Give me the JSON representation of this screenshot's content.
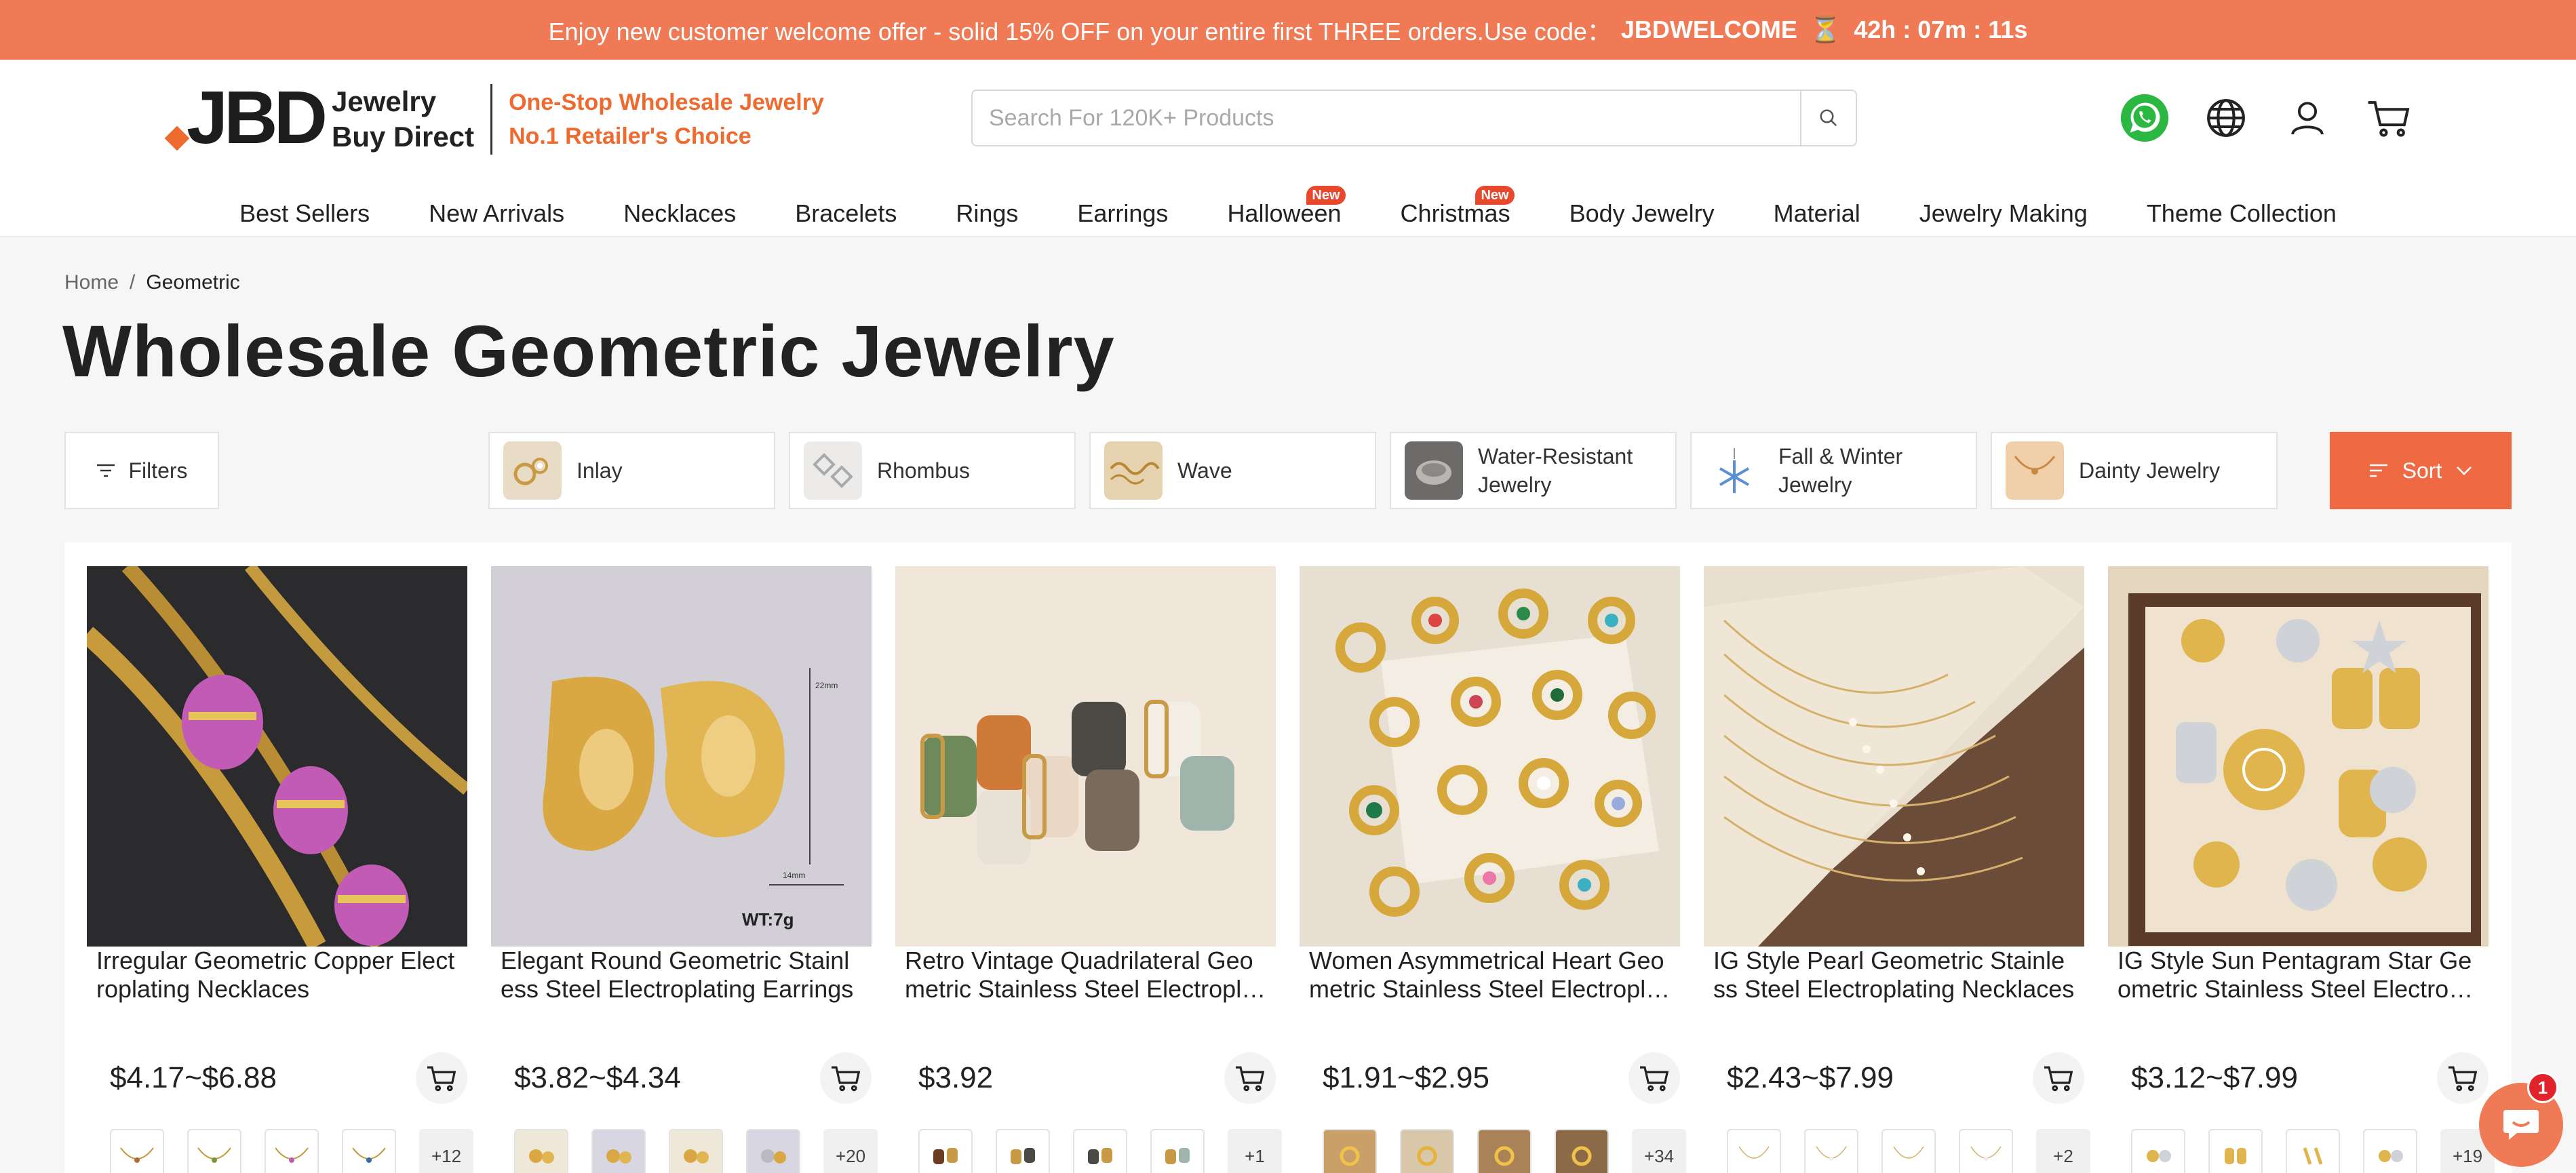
{
  "promo": {
    "text": "Enjoy new customer welcome offer - solid 15% OFF on your entire first THREE orders.Use code：",
    "code": "JBDWELCOME",
    "timer": "42h : 07m : 11s"
  },
  "header": {
    "logo_mark": "JBD",
    "logo_line1": "Jewelry",
    "logo_line2": "Buy Direct",
    "tagline1": "One-Stop Wholesale Jewelry",
    "tagline2": "No.1 Retailer's Choice",
    "search_placeholder": "Search For 120K+ Products"
  },
  "nav": [
    {
      "label": "Best Sellers",
      "badge": ""
    },
    {
      "label": "New Arrivals",
      "badge": ""
    },
    {
      "label": "Necklaces",
      "badge": ""
    },
    {
      "label": "Bracelets",
      "badge": ""
    },
    {
      "label": "Rings",
      "badge": ""
    },
    {
      "label": "Earrings",
      "badge": ""
    },
    {
      "label": "Halloween",
      "badge": "New"
    },
    {
      "label": "Christmas",
      "badge": "New"
    },
    {
      "label": "Body Jewelry",
      "badge": ""
    },
    {
      "label": "Material",
      "badge": ""
    },
    {
      "label": "Jewelry Making",
      "badge": ""
    },
    {
      "label": "Theme Collection",
      "badge": ""
    }
  ],
  "breadcrumb": {
    "home": "Home",
    "separator": "/",
    "current": "Geometric"
  },
  "page_title": "Wholesale Geometric Jewelry",
  "filters_label": "Filters",
  "sort_label": "Sort",
  "chips": [
    {
      "label": "Inlay",
      "color": "#e9dcc7"
    },
    {
      "label": "Rhombus",
      "color": "#ecebea"
    },
    {
      "label": "Wave",
      "color": "#e7d2b0"
    },
    {
      "label": "Water-Resistant Jewelry",
      "color": "#6d6b69"
    },
    {
      "label": "Fall & Winter Jewelry",
      "color": "#d7e3f2"
    },
    {
      "label": "Dainty Jewelry",
      "color": "#f1cfa8"
    }
  ],
  "products": [
    {
      "title": "Irregular Geometric Copper Electroplating Necklaces",
      "price": "$4.17~$6.88",
      "more": "+12",
      "bg": "#2b2a2c",
      "accent": "#c25bb5"
    },
    {
      "title": "Elegant Round Geometric Stainless Steel Electroplating Earrings",
      "price": "$3.82~$4.34",
      "more": "+20",
      "bg": "#cfcdd3",
      "accent": "#d4a64a",
      "overlay": "WT:7g"
    },
    {
      "title": "Retro Vintage Quadrilateral Geometric Stainless Steel Electroplating Earrings",
      "price": "$3.92",
      "more": "+1",
      "bg": "#efe4d8",
      "accent": "#a7774a"
    },
    {
      "title": "Women Asymmetrical Heart Geometric Stainless Steel Electroplating Rings",
      "price": "$1.91~$2.95",
      "more": "+34",
      "bg": "#e9e1d4",
      "accent": "#d6a83c"
    },
    {
      "title": "IG Style Pearl Geometric Stainless Steel Electroplating Necklaces",
      "price": "$2.43~$7.99",
      "more": "+2",
      "bg": "#6b4c38",
      "accent": "#e5c98d"
    },
    {
      "title": "IG Style Sun Pentagram Star Geometric Stainless Steel Electroplating Earrings",
      "price": "$3.12~$7.99",
      "more": "+19",
      "bg": "#5a3b2a",
      "accent": "#e2c27a"
    }
  ],
  "chat_badge": "1",
  "colors": {
    "brand": "#ef7a55",
    "sort": "#ef6a43",
    "badge": "#e8482c"
  }
}
